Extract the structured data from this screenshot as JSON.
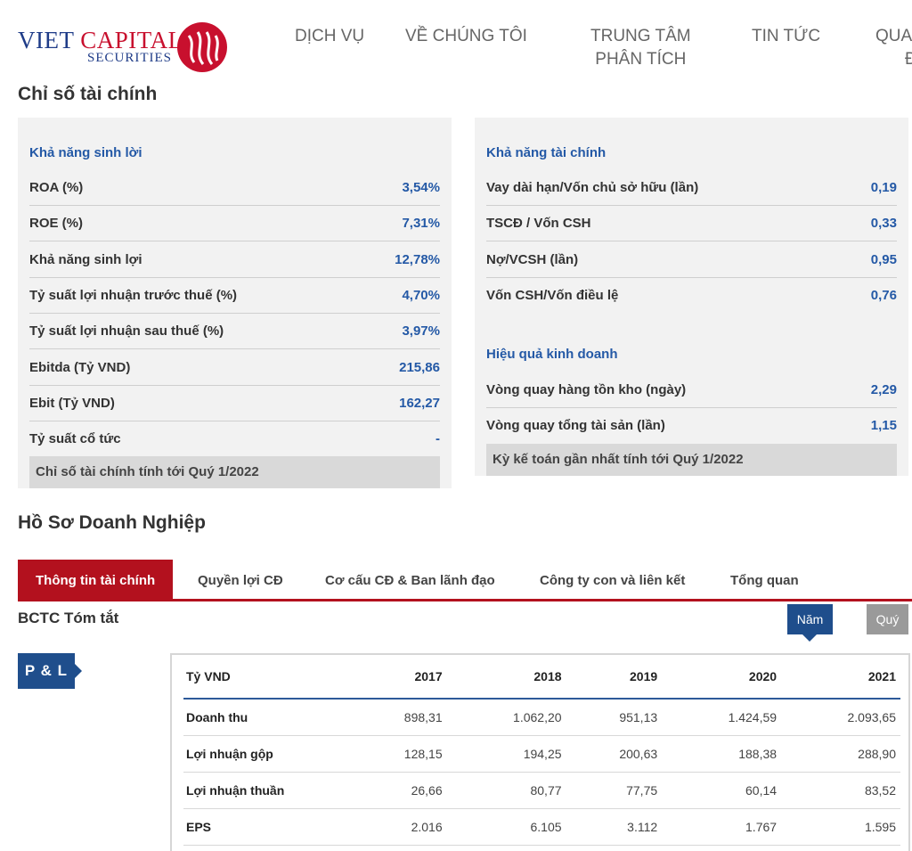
{
  "logo": {
    "word1": "VIET",
    "word2": "CAPITAL",
    "word3": "SECURITIES"
  },
  "nav": {
    "dich_vu": "DỊCH VỤ",
    "ve_chung_toi": "VỀ CHÚNG TÔI",
    "trung_tam_1": "TRUNG TÂM",
    "trung_tam_2": "PHÂN TÍCH",
    "tin_tuc": "TIN TỨC",
    "cut_1": "QUA",
    "cut_2": "Đ"
  },
  "ratios": {
    "title": "Chỉ số tài chính",
    "left": {
      "group": "Khả năng sinh lời",
      "rows": [
        {
          "label": "ROA (%)",
          "value": "3,54%"
        },
        {
          "label": "ROE (%)",
          "value": "7,31%"
        },
        {
          "label": "Khả năng sinh lợi",
          "value": "12,78%"
        },
        {
          "label": "Tỷ suất lợi nhuận trước thuế (%)",
          "value": "4,70%"
        },
        {
          "label": "Tỷ suất lợi nhuận sau thuế (%)",
          "value": "3,97%"
        },
        {
          "label": "Ebitda (Tỷ VND)",
          "value": "215,86"
        },
        {
          "label": "Ebit (Tỷ VND)",
          "value": "162,27"
        },
        {
          "label": "Tỷ suất cổ tức",
          "value": "-"
        }
      ],
      "note": "Chỉ số tài chính tính tới Quý 1/2022"
    },
    "right": {
      "group1": "Khả năng tài chính",
      "rows1": [
        {
          "label": "Vay dài hạn/Vốn chủ sở hữu (lần)",
          "value": "0,19"
        },
        {
          "label": "TSCĐ / Vốn CSH",
          "value": "0,33"
        },
        {
          "label": "Nợ/VCSH (lần)",
          "value": "0,95"
        },
        {
          "label": "Vốn CSH/Vốn điều lệ",
          "value": "0,76"
        }
      ],
      "group2": "Hiệu quả kinh doanh",
      "rows2": [
        {
          "label": "Vòng quay hàng tồn kho (ngày)",
          "value": "2,29"
        },
        {
          "label": "Vòng quay tổng tài sản (lần)",
          "value": "1,15"
        }
      ],
      "note": "Kỳ kế toán gần nhất tính tới Quý 1/2022"
    }
  },
  "profile": {
    "title": "Hồ Sơ Doanh Nghiệp",
    "tabs": [
      "Thông tin tài chính",
      "Quyền lợi CĐ",
      "Cơ cấu CĐ & Ban lãnh đạo",
      "Công ty con và liên kết",
      "Tổng quan"
    ],
    "bctc_title": "BCTC Tóm tắt",
    "btn_year": "Năm",
    "btn_quarter": "Quý",
    "pl_label": "P & L",
    "table": {
      "unit": "Tỷ VND",
      "years": [
        "2017",
        "2018",
        "2019",
        "2020",
        "2021"
      ],
      "rows": [
        {
          "label": "Doanh thu",
          "values": [
            "898,31",
            "1.062,20",
            "951,13",
            "1.424,59",
            "2.093,65"
          ]
        },
        {
          "label": "Lợi nhuận gộp",
          "values": [
            "128,15",
            "194,25",
            "200,63",
            "188,38",
            "288,90"
          ]
        },
        {
          "label": "Lợi nhuận thuần",
          "values": [
            "26,66",
            "80,77",
            "77,75",
            "60,14",
            "83,52"
          ]
        },
        {
          "label": "EPS",
          "values": [
            "2.016",
            "6.105",
            "3.112",
            "1.767",
            "1.595"
          ]
        }
      ]
    }
  }
}
